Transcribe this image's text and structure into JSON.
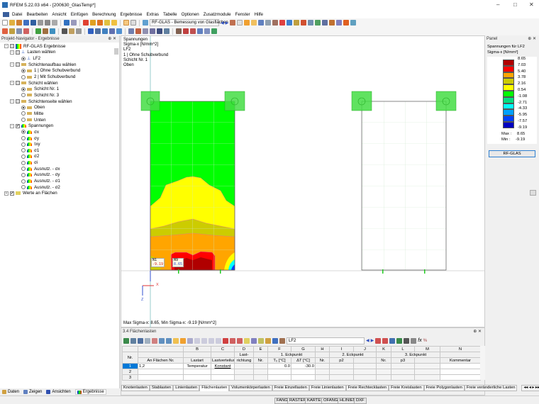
{
  "window": {
    "title": "RFEM 5.22.03 x64 - [200630_GlasTemp*]"
  },
  "menu": [
    "Datei",
    "Bearbeiten",
    "Ansicht",
    "Einfügen",
    "Berechnung",
    "Ergebnisse",
    "Extras",
    "Tabelle",
    "Optionen",
    "Zusatzmodule",
    "Fenster",
    "Hilfe"
  ],
  "toolbar": {
    "module_combo": "RF-GLAS - Bemessung von Glasflächen"
  },
  "navigator": {
    "title": "Projekt-Navigator - Ergebnisse",
    "items": [
      {
        "label": "RF-GLAS Ergebnisse",
        "kind": "root"
      },
      {
        "label": "Lasten wählen",
        "kind": "group"
      },
      {
        "label": "LF2",
        "kind": "radio",
        "on": true
      },
      {
        "label": "Schichtenaufbau wählen",
        "kind": "group"
      },
      {
        "label": "1 | Ohne Schubverbund",
        "kind": "radio",
        "on": true
      },
      {
        "label": "2 | Mit Schubverbund",
        "kind": "radio",
        "on": false
      },
      {
        "label": "Schicht wählen",
        "kind": "group"
      },
      {
        "label": "Schicht Nr. 1",
        "kind": "radio",
        "on": true
      },
      {
        "label": "Schicht Nr. 3",
        "kind": "radio",
        "on": false
      },
      {
        "label": "Schichtenseite wählen",
        "kind": "group"
      },
      {
        "label": "Oben",
        "kind": "radio",
        "on": true
      },
      {
        "label": "Mitte",
        "kind": "radio",
        "on": false
      },
      {
        "label": "Unten",
        "kind": "radio",
        "on": false
      },
      {
        "label": "Spannungen",
        "kind": "check"
      },
      {
        "label": "σx",
        "kind": "radio",
        "on": true
      },
      {
        "label": "σy",
        "kind": "radio",
        "on": false
      },
      {
        "label": "τxy",
        "kind": "radio",
        "on": false
      },
      {
        "label": "σ1",
        "kind": "radio",
        "on": false
      },
      {
        "label": "σ2",
        "kind": "radio",
        "on": false
      },
      {
        "label": "σi",
        "kind": "radio",
        "on": false
      },
      {
        "label": "Ausnutz. - σx",
        "kind": "radio",
        "on": false
      },
      {
        "label": "Ausnutz. - σy",
        "kind": "radio",
        "on": false
      },
      {
        "label": "Ausnutz. - σ1",
        "kind": "radio",
        "on": false
      },
      {
        "label": "Ausnutz. - σ2",
        "kind": "radio",
        "on": false
      },
      {
        "label": "Werte an Flächen",
        "kind": "checkroot"
      }
    ],
    "tabs": [
      "Daten",
      "Zeigen",
      "Ansichten",
      "Ergebnisse"
    ]
  },
  "view": {
    "info": [
      "Spannungen",
      "Sigma-x [N/mm^2]",
      "LF2",
      "1 | Ohne Schubverbund",
      "Schicht Nr. 1",
      "Oben"
    ],
    "labels": {
      "min_node": "N1",
      "min_value": "-9.19",
      "max_node": "N9",
      "max_value": "8.65",
      "axis_x": "X",
      "axis_z": "Z"
    },
    "status": "Max Sigma-x: 8.65, Min Sigma-x: -9.19 [N/mm^2]"
  },
  "panel": {
    "title": "Panel",
    "heading": "Spannungen für LF2",
    "unit": "Sigma-x [N/mm²]",
    "legend": [
      {
        "value": "8.65",
        "color": "#b00000"
      },
      {
        "value": "7.03",
        "color": "#ff0000"
      },
      {
        "value": "5.40",
        "color": "#ffa500"
      },
      {
        "value": "3.78",
        "color": "#cccc00"
      },
      {
        "value": "2.16",
        "color": "#ffff00"
      },
      {
        "value": "0.54",
        "color": "#00ff00"
      },
      {
        "value": "-1.08",
        "color": "#00dd80"
      },
      {
        "value": "-2.71",
        "color": "#00ffff"
      },
      {
        "value": "-4.33",
        "color": "#00a0ff"
      },
      {
        "value": "-5.95",
        "color": "#0040ff"
      },
      {
        "value": "-7.57",
        "color": "#0000c0"
      },
      {
        "value": "-9.19",
        "color": null
      }
    ],
    "max_label": "Max :",
    "max": "8.65",
    "min_label": "Min :",
    "min": "-9.19",
    "button": "RF-GLAS"
  },
  "table": {
    "title": "3.4 Flächenlasten",
    "combo": "LF2",
    "letters": [
      "A",
      "B",
      "C",
      "D",
      "E",
      "F",
      "G",
      "H",
      "I",
      "J",
      "K",
      "L",
      "M",
      "N"
    ],
    "groups": {
      "d": "Last-",
      "f": "1. Eckpunkt",
      "i": "2. Eckpunkt",
      "l": "3. Eckpunkt"
    },
    "headers": [
      "Nr.",
      "An Flächen Nr.",
      "Lastart",
      "Lastverteilung",
      "richtung",
      "Nr.",
      "T₀ [°C]",
      "ΔT [°C]",
      "Nr.",
      "p2",
      "",
      "Nr.",
      "p3",
      "",
      "Kommentar"
    ],
    "rows": [
      [
        "1",
        "1,2",
        "Temperatur",
        "Konstant",
        "",
        "",
        "0.0",
        "-30.0",
        "",
        "",
        "",
        "",
        "",
        "",
        ""
      ],
      [
        "2",
        "",
        "",
        "",
        "",
        "",
        "",
        "",
        "",
        "",
        "",
        "",
        "",
        "",
        ""
      ],
      [
        "3",
        "",
        "",
        "",
        "",
        "",
        "",
        "",
        "",
        "",
        "",
        "",
        "",
        "",
        ""
      ]
    ],
    "tabs": [
      "Knotenlasten",
      "Stablasten",
      "Linienlasten",
      "Flächenlasten",
      "Volumenkörperlasten",
      "Freie Einzellasten",
      "Freie Linienlasten",
      "Freie Rechtecklasten",
      "Freie Kreislasten",
      "Freie Polygonlasten",
      "Freie veränderliche Lasten"
    ],
    "active_tab": "Flächenlasten"
  },
  "statusbar": [
    "FANG",
    "RASTER",
    "KARTES",
    "OFANG",
    "HLINIEN",
    "DXF"
  ]
}
